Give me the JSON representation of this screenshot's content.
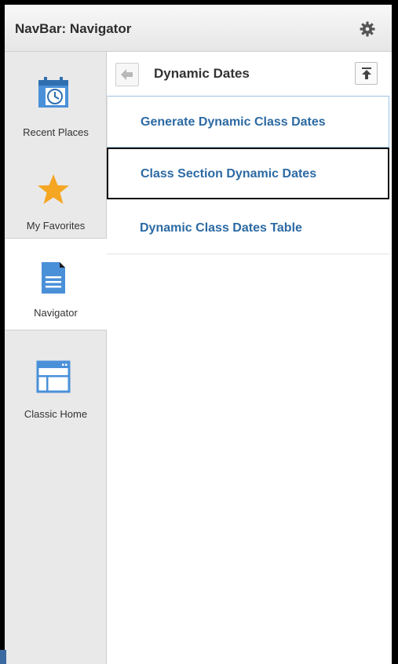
{
  "header": {
    "title": "NavBar: Navigator",
    "settings_icon": "gear-icon"
  },
  "rail": {
    "items": [
      {
        "label": "Recent Places",
        "icon": "calendar-clock-icon",
        "active": false
      },
      {
        "label": "My Favorites",
        "icon": "star-icon",
        "active": false
      },
      {
        "label": "Navigator",
        "icon": "document-icon",
        "active": true
      },
      {
        "label": "Classic Home",
        "icon": "window-icon",
        "active": false
      }
    ]
  },
  "content": {
    "folder_title": "Dynamic Dates",
    "items": [
      {
        "label": "Generate Dynamic Class Dates"
      },
      {
        "label": "Class Section Dynamic Dates"
      },
      {
        "label": "Dynamic Class Dates Table"
      }
    ]
  },
  "colors": {
    "link": "#2c6aa3",
    "accent_blue": "#4a90d9",
    "star": "#f5a623",
    "rail_bg": "#e9e9e9"
  }
}
